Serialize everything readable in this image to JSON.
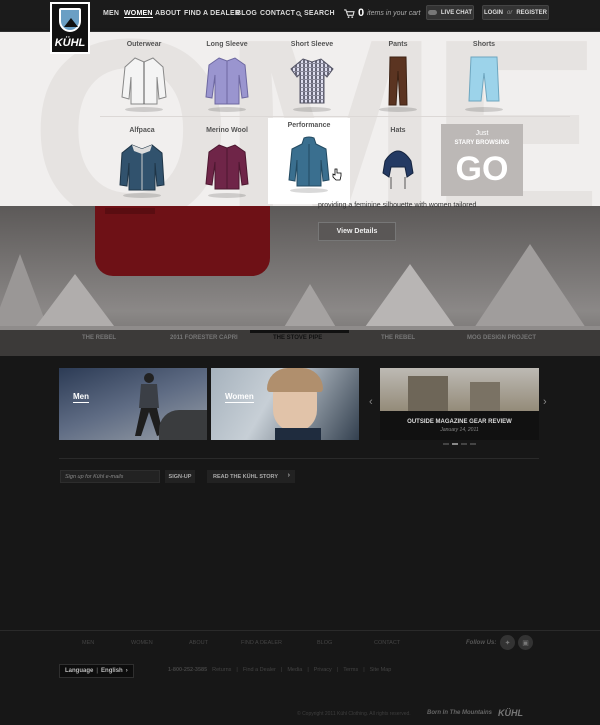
{
  "brand": {
    "logo_text": "KÜHL"
  },
  "nav": {
    "items": [
      {
        "label": "MEN"
      },
      {
        "label": "WOMEN"
      },
      {
        "label": "ABOUT"
      },
      {
        "label": "FIND A DEALER"
      },
      {
        "label": "BLOG"
      },
      {
        "label": "CONTACT"
      },
      {
        "label": "SEARCH"
      }
    ],
    "cart_count": "0",
    "cart_label": "items in your cart",
    "live_chat": "LIVE CHAT",
    "login": "LOGIN",
    "or": "or",
    "register": "REGISTER"
  },
  "mega_menu": {
    "categories": [
      {
        "label": "Outerwear"
      },
      {
        "label": "Long Sleeve"
      },
      {
        "label": "Short Sleeve"
      },
      {
        "label": "Pants"
      },
      {
        "label": "Shorts"
      },
      {
        "label": "Alfpaca"
      },
      {
        "label": "Merino Wool"
      },
      {
        "label": "Performance"
      },
      {
        "label": "Hats"
      }
    ],
    "go_box": {
      "just": "Just",
      "browsing": "STARY BROWSING",
      "go": "GO"
    }
  },
  "hero": {
    "text": "providing a feminine silhouette with women tailored",
    "view_details": "View Details",
    "tabs": [
      {
        "label": "THE REBEL"
      },
      {
        "label": "2011 FORESTER CAPRI"
      },
      {
        "label": "THE STOVE PIPE"
      },
      {
        "label": "THE REBEL"
      },
      {
        "label": "MOG DESIGN PROJECT"
      }
    ]
  },
  "promos": {
    "men": "Men",
    "women": "Women",
    "outside_title": "OUTSIDE MAGAZINE GEAR REVIEW",
    "outside_date": "January 14, 2011"
  },
  "signup": {
    "placeholder": "Sign up for Kühl e-mails",
    "button": "SIGN-UP",
    "story": "READ THE KÜHL STORY"
  },
  "footer": {
    "nav": [
      {
        "label": "MEN"
      },
      {
        "label": "WOMEN"
      },
      {
        "label": "ABOUT"
      },
      {
        "label": "FIND A DEALER"
      },
      {
        "label": "BLOG"
      },
      {
        "label": "CONTACT"
      }
    ],
    "follow": "Follow Us:",
    "language_label": "Language",
    "language_value": "English",
    "phone": "1-800-252-3585",
    "links": [
      {
        "label": "Returns"
      },
      {
        "label": "Find a Dealer"
      },
      {
        "label": "Media"
      },
      {
        "label": "Privacy"
      },
      {
        "label": "Terms"
      },
      {
        "label": "Site Map"
      }
    ],
    "copyright": "© Copyright 2011 Kühl Clothing. All rights reserved.",
    "tagline": "Born In The Mountains",
    "logo_text": "KÜHL"
  },
  "colors": {
    "accent": "#6b9fc4",
    "background": "#171717",
    "menu_bg": "#f1efee"
  }
}
